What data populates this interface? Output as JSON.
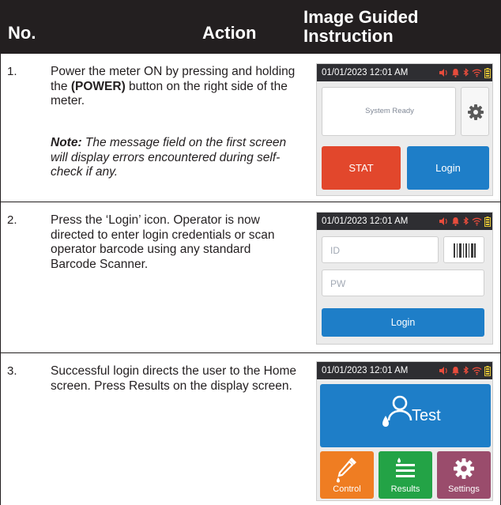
{
  "header": {
    "no": "No.",
    "action": "Action",
    "image": "Image Guided Instruction"
  },
  "colors": {
    "header_bg": "#231f20",
    "stat": "#e2472c",
    "login": "#1e7ec8",
    "test": "#1e7ec8",
    "control": "#ef7d22",
    "results": "#23a346",
    "settings": "#9a4c6c"
  },
  "steps": [
    {
      "number": "1.",
      "text_before": "Power the meter ON by pressing and holding the ",
      "text_bold": "(POWER)",
      "text_after": " button on the right side of the meter.",
      "note_label": "Note:",
      "note_text": " The message field on the first screen will display errors encountered during self-check if any.",
      "screen": {
        "datetime": "01/01/2023 12:01 AM",
        "status_icons": [
          "volume-icon",
          "bell-icon",
          "bluetooth-icon",
          "wifi-icon",
          "battery-icon"
        ],
        "message": "System Ready",
        "gear": "gear-icon",
        "stat_label": "STAT",
        "login_label": "Login"
      }
    },
    {
      "number": "2.",
      "text": "Press the ‘Login’ icon. Operator is now directed to enter login credentials or scan operator barcode using any standard Barcode Scanner.",
      "screen": {
        "datetime": "01/01/2023 12:01 AM",
        "id_placeholder": "ID",
        "pw_placeholder": "PW",
        "barcode": "barcode-icon",
        "login_label": "Login"
      }
    },
    {
      "number": "3.",
      "text": "Successful login directs the user to the Home screen. Press Results on the display screen.",
      "screen": {
        "datetime": "01/01/2023 12:01 AM",
        "test_label": "Test",
        "control_label": "Control",
        "results_label": "Results",
        "settings_label": "Settings"
      }
    }
  ]
}
